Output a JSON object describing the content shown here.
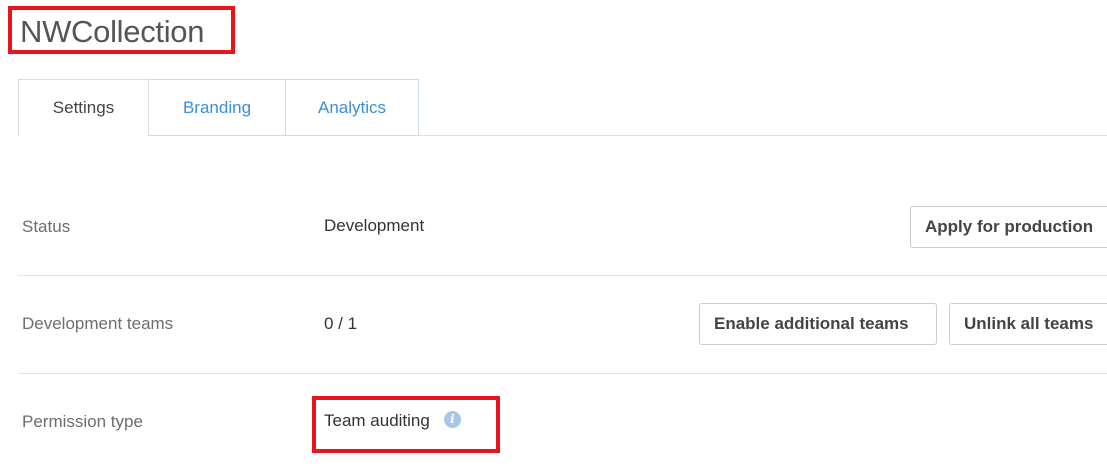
{
  "header": {
    "title": "NWCollection"
  },
  "tabs": [
    {
      "label": "Settings",
      "active": true
    },
    {
      "label": "Branding",
      "active": false
    },
    {
      "label": "Analytics",
      "active": false
    }
  ],
  "settings": {
    "status": {
      "label": "Status",
      "value": "Development",
      "apply_button": "Apply for production"
    },
    "development_teams": {
      "label": "Development teams",
      "value": "0 / 1",
      "enable_button": "Enable additional teams",
      "unlink_button": "Unlink all teams"
    },
    "permission_type": {
      "label": "Permission type",
      "value": "Team auditing",
      "info_icon": "info-icon"
    }
  },
  "colors": {
    "highlight": "#e8141c",
    "link_tab": "#3a8fd8",
    "info_icon": "#a9c6e8"
  }
}
